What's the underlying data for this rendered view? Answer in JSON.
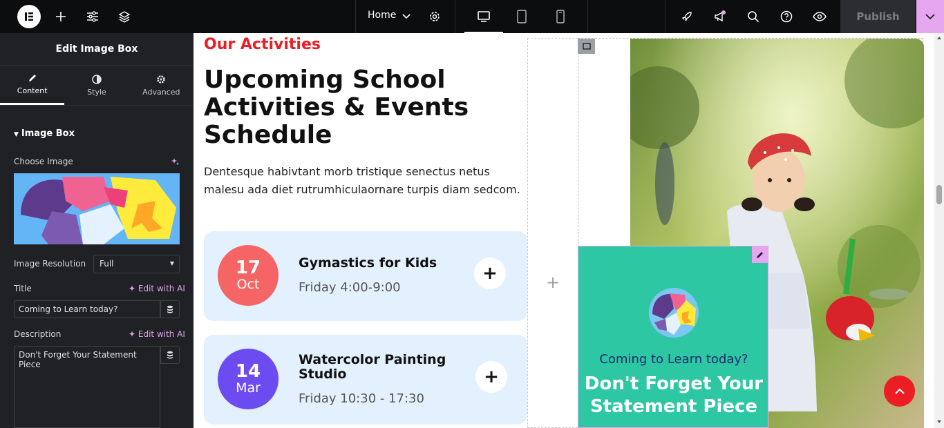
{
  "topbar": {
    "page_name": "Home",
    "publish_label": "Publish",
    "icons": [
      "elementor-logo-icon",
      "add-element-icon",
      "settings-sliders-icon",
      "layers-icon",
      "chevron-down-icon",
      "page-settings-gear-icon",
      "desktop-icon",
      "tablet-icon",
      "mobile-icon",
      "rocket-icon",
      "megaphone-icon",
      "search-icon",
      "help-icon",
      "preview-eye-icon"
    ],
    "accent": "#e6a7f0"
  },
  "panel": {
    "title": "Edit Image Box",
    "tabs": [
      {
        "label": "Content",
        "icon": "pencil-icon"
      },
      {
        "label": "Style",
        "icon": "half-circle-icon"
      },
      {
        "label": "Advanced",
        "icon": "gear-icon"
      }
    ],
    "section": "Image Box",
    "choose_image_label": "Choose Image",
    "resolution_label": "Image Resolution",
    "resolution_value": "Full",
    "title_label": "Title",
    "edit_ai_label": "Edit with AI",
    "title_value": "Coming to Learn today?",
    "description_label": "Description",
    "description_value": "Don't Forget Your Statement Piece"
  },
  "page": {
    "subtitle": "Our Activities",
    "heading": "Upcoming School Activities & Events Schedule",
    "paragraph": "Dentesque habivtant morb tristique senectus netus malesu ada diet rutrumhiculaornare turpis diam sedcom.",
    "events": [
      {
        "day": "17",
        "month": "Oct",
        "title": "Gymastics for Kids",
        "time": "Friday 4:00-9:00",
        "color": "#f56565"
      },
      {
        "day": "14",
        "month": "Mar",
        "title": "Watercolor Painting Studio",
        "time": "Friday 10:30 - 17:30",
        "color": "#6c4cf0"
      }
    ],
    "image_box": {
      "title": "Coming to Learn today?",
      "description": "Don't Forget Your Statement Piece",
      "bg": "#2ec7a3"
    }
  }
}
